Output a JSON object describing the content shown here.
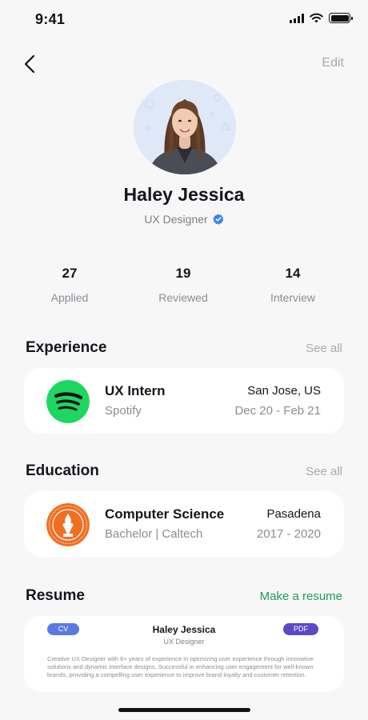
{
  "status_bar": {
    "time": "9:41"
  },
  "header": {
    "edit_label": "Edit"
  },
  "profile": {
    "name": "Haley Jessica",
    "role": "UX Designer"
  },
  "stats": [
    {
      "value": "27",
      "label": "Applied"
    },
    {
      "value": "19",
      "label": "Reviewed"
    },
    {
      "value": "14",
      "label": "Interview"
    }
  ],
  "experience": {
    "title": "Experience",
    "see_all": "See all",
    "item": {
      "title": "UX Intern",
      "company": "Spotify",
      "location": "San Jose, US",
      "dates": "Dec 20 - Feb 21",
      "logo_icon": "spotify-logo-icon"
    }
  },
  "education": {
    "title": "Education",
    "see_all": "See all",
    "item": {
      "title": "Computer Science",
      "subtitle": "Bachelor | Caltech",
      "location": "Pasadena",
      "years": "2017 - 2020",
      "logo_icon": "caltech-seal-icon"
    }
  },
  "resume": {
    "title": "Resume",
    "action": "Make a resume",
    "cv_badge": "CV",
    "pdf_badge": "PDF",
    "name": "Haley Jessica",
    "role": "UX Designer",
    "summary": "Creative UX Designer with 6+ years of experience in optimizing user experience through innovative solutions and dynamic interface designs. Successful in enhancing user engagement for well-known brands, providing a compelling user experience to improve brand loyalty and customer retention."
  },
  "colors": {
    "accent_green": "#1e9d55",
    "spotify_green": "#1ed760",
    "caltech_orange": "#f26e21",
    "verified_blue": "#3a86e8",
    "cv_badge": "#5a79e3",
    "pdf_badge": "#5b49c8"
  }
}
